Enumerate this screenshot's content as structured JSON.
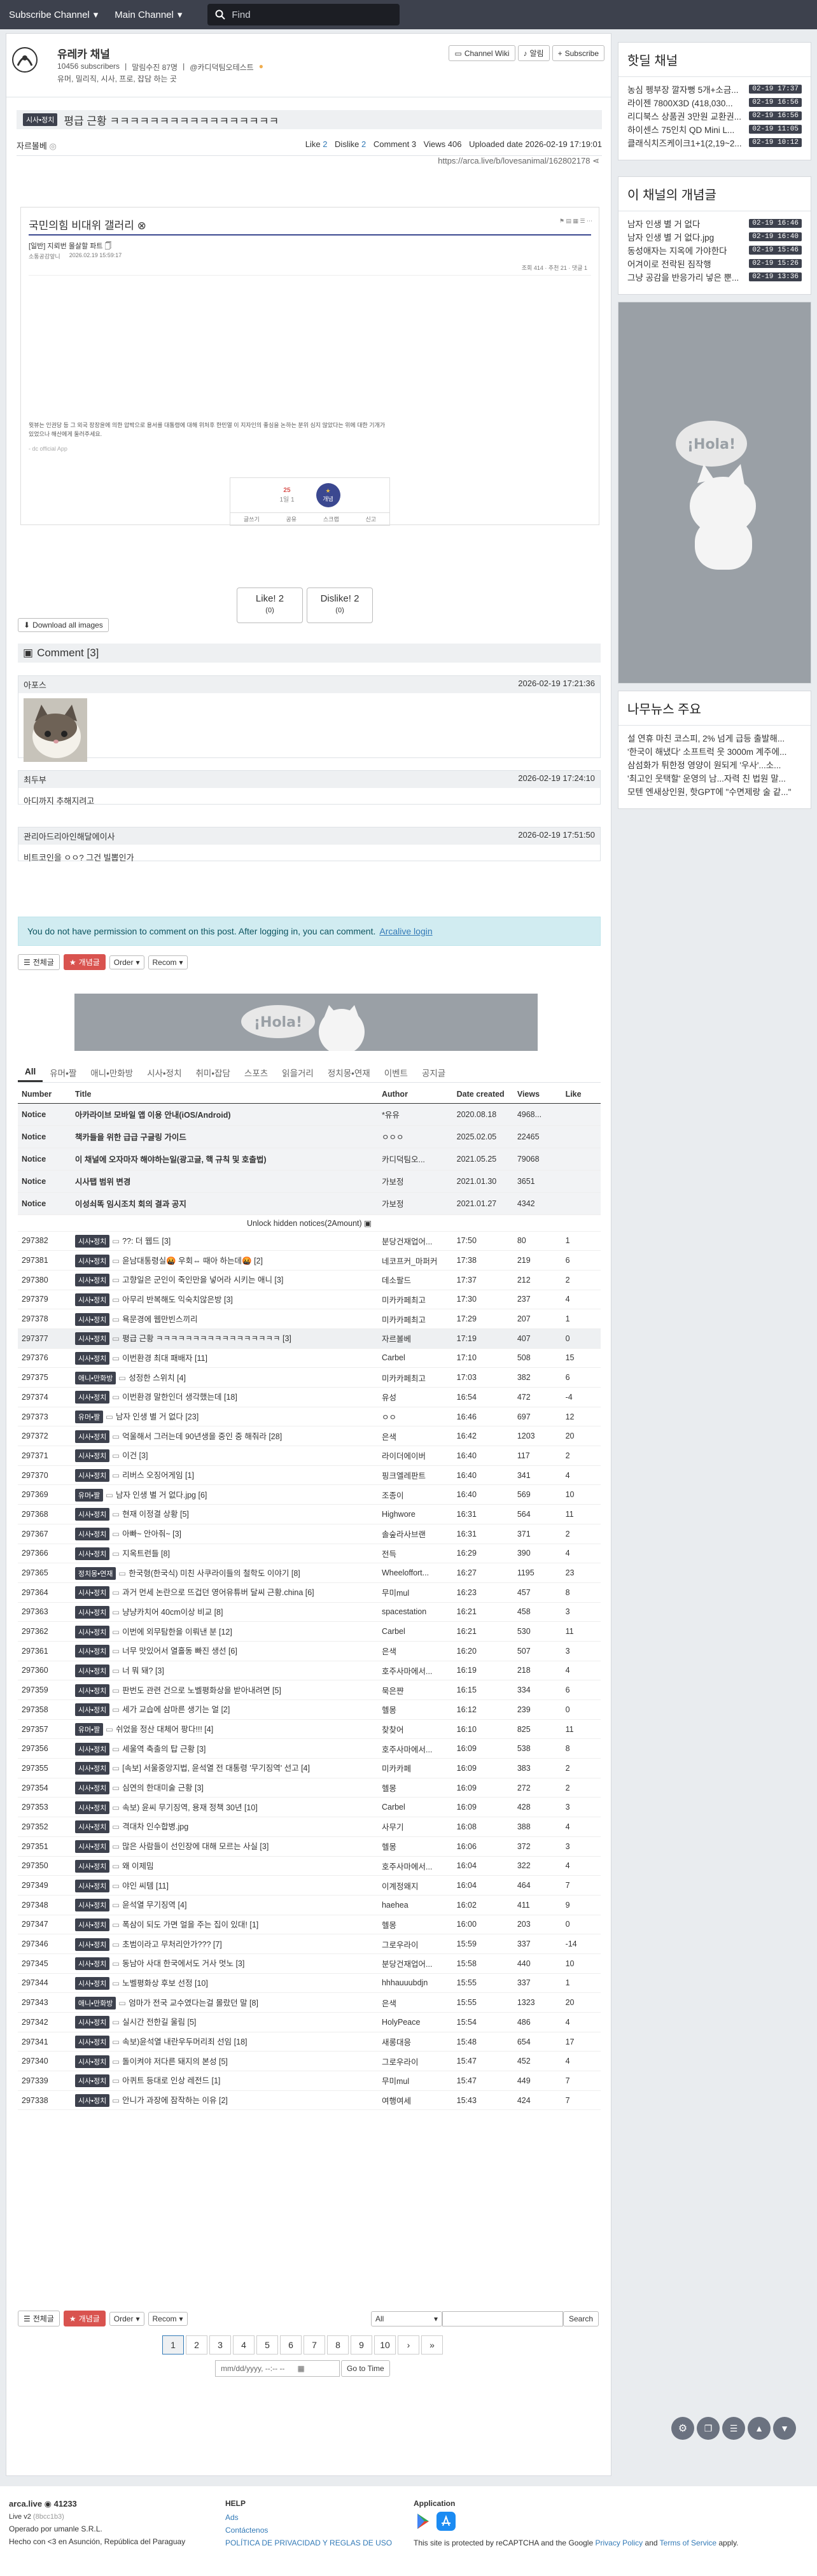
{
  "nav": {
    "subscribe": "Subscribe Channel",
    "main": "Main Channel",
    "search_placeholder": "Find"
  },
  "channel": {
    "title": "유레카 채널",
    "subscribers": "10456 subscribers",
    "admin": "말림수진 87명",
    "tag": "@카디덕팀오테스트",
    "desc": "유머, 밀리직, 시사, 프로, 잡담 하는 곳",
    "wiki": "Channel Wiki",
    "alarm": "알림",
    "subscribe": "Subscribe"
  },
  "post": {
    "category": "시사•정치",
    "title": "평급 근황 ㅋㅋㅋㅋㅋㅋㅋㅋㅋㅋㅋㅋㅋㅋㅋㅋㅋ",
    "author": "자르볼베",
    "like_label": "Like",
    "like": "2",
    "dislike_label": "Dislike",
    "dislike": "2",
    "comment_label": "Comment",
    "comment": "3",
    "views_label": "Views",
    "views": "406",
    "uploaded_label": "Uploaded date",
    "uploaded": "2026-02-19 17:19:01",
    "url": "https://arca.live/b/lovesanimal/162802178",
    "embed_title": "국민의힘 비대위 갤러리 ⊗",
    "embed_sub": "[일반] 지뢰번 몰살할 파트 🗍",
    "embed_author": "소통공감앞니",
    "embed_date": "2026.02.19 15:59:17",
    "embed_stats": "조회 414 · 추천 21 · 댓글 1",
    "embed_body": "윗뷰는 인권당 등 그 외국 장장윤에 의한 압박으로 용서를 대통령에 대해 위처후 한민열 이 지자인의 좋심을 논하는 분위 심지 않았다는 위에 대한 기개가\n있었으나 해산에게 둘러주세요.",
    "embed_src": "- dc official App",
    "react_cnt": "25",
    "react_sub": "1일 1",
    "react_btn": "개념",
    "act_write": "글쓰기",
    "act_share": "공유",
    "act_report": "신고",
    "act_copy": "스크랩"
  },
  "like_btn": {
    "like": "Like!",
    "like_n": "2",
    "like_sub": "0",
    "dislike": "Dislike!",
    "dislike_n": "2",
    "dislike_sub": "0"
  },
  "download": "Download all images",
  "comments_title": "Comment [3]",
  "comments": [
    {
      "author": "아포스",
      "date": "2026-02-19 17:21:36",
      "body": ""
    },
    {
      "author": "최두부",
      "date": "2026-02-19 17:24:10",
      "body": "아디까지 추해지려고"
    },
    {
      "author": "관리아드리아인해달에이사",
      "date": "2026-02-19 17:51:50",
      "body": "비트코인을 ㅇㅇ? 그건 빌뽑인가"
    }
  ],
  "alert": {
    "text": "You do not have permission to comment on this post. After logging in, you can comment.",
    "link": "Arcalive login"
  },
  "tools": {
    "all": "전체글",
    "best": "개념글",
    "order": "Order",
    "recom": "Recom"
  },
  "tabs": [
    "All",
    "유머•짤",
    "애니•만화방",
    "시사•정치",
    "취미•잡담",
    "스포츠",
    "읽을거리",
    "정치몽•연재",
    "이벤트",
    "공지글"
  ],
  "table_headers": {
    "number": "Number",
    "title": "Title",
    "author": "Author",
    "date": "Date created",
    "views": "Views",
    "like": "Like"
  },
  "notices": [
    {
      "title": "아카라이브 모바일 앱 이용 안내(iOS/Android)",
      "author": "*유유",
      "date": "2020.08.18",
      "views": "4968..."
    },
    {
      "title": "책카들을 위한 급급 구글링 가이드",
      "author": "ㅇㅇㅇ",
      "date": "2025.02.05",
      "views": "22465"
    },
    {
      "title": "이 채널에 오자마자 해야하는일(광고글, 핵 규칙 및 호출법)",
      "author": "카디덕팀오...",
      "date": "2021.05.25",
      "views": "79068"
    },
    {
      "title": "시사탭 범위 변경",
      "author": "가보정",
      "date": "2021.01.30",
      "views": "3651"
    },
    {
      "title": "이성쇠똑 임시조치 회의 결과 공지",
      "author": "가보정",
      "date": "2021.01.27",
      "views": "4342"
    }
  ],
  "notice_label": "Notice",
  "unlock": "Unlock hidden notices(2Amount)",
  "posts": [
    {
      "n": "297382",
      "c": "시사•정치",
      "t": "??: 더 웹드 [3]",
      "a": "분당건재업어...",
      "d": "17:50",
      "v": "80",
      "l": "1"
    },
    {
      "n": "297381",
      "c": "시사•정치",
      "t": "윤남대통령실🤬 우회⇔ 때아 하는데🤬 [2]",
      "a": "네코프커_마퍼커",
      "d": "17:38",
      "v": "219",
      "l": "6"
    },
    {
      "n": "297380",
      "c": "시사•정치",
      "t": "고향일은 군인이 죽인만을 넣어라 시키는 애니 [3]",
      "a": "데소팔드",
      "d": "17:37",
      "v": "212",
      "l": "2"
    },
    {
      "n": "297379",
      "c": "시사•정치",
      "t": "아무리 반복해도 익숙치않은방 [3]",
      "a": "미카카페최고",
      "d": "17:30",
      "v": "237",
      "l": "4"
    },
    {
      "n": "297378",
      "c": "시사•정치",
      "t": "욕문경에 웹만빈스끼리",
      "a": "미카카페최고",
      "d": "17:29",
      "v": "207",
      "l": "1"
    },
    {
      "n": "297377",
      "c": "시사•정치",
      "t": "평급 근황 ㅋㅋㅋㅋㅋㅋㅋㅋㅋㅋㅋㅋㅋㅋㅋㅋㅋ [3]",
      "a": "자르볼베",
      "d": "17:19",
      "v": "407",
      "l": "0"
    },
    {
      "n": "297376",
      "c": "시사•정치",
      "t": "이번환경 최대 패배자 [11]",
      "a": "Carbel",
      "d": "17:10",
      "v": "508",
      "l": "15"
    },
    {
      "n": "297375",
      "c": "애니•만화방",
      "t": "성정한 스위치 [4]",
      "a": "미카카페최고",
      "d": "17:03",
      "v": "382",
      "l": "6"
    },
    {
      "n": "297374",
      "c": "시사•정치",
      "t": "이번환경 말한인더 생각했는데 [18]",
      "a": "유성",
      "d": "16:54",
      "v": "472",
      "l": "-4"
    },
    {
      "n": "297373",
      "c": "유머•짤",
      "t": "남자 인생 별 거 없다 [23]",
      "a": "ㅇㅇ",
      "d": "16:46",
      "v": "697",
      "l": "12"
    },
    {
      "n": "297372",
      "c": "시사•정치",
      "t": "억울해서 그러는데 90년생을 중인 중 해줘라 [28]",
      "a": "은색",
      "d": "16:42",
      "v": "1203",
      "l": "20"
    },
    {
      "n": "297371",
      "c": "시사•정치",
      "t": "이건 [3]",
      "a": "라이더에이버",
      "d": "16:40",
      "v": "117",
      "l": "2"
    },
    {
      "n": "297370",
      "c": "시사•정치",
      "t": "리버스 오징어게임 [1]",
      "a": "핑크엘레판트",
      "d": "16:40",
      "v": "341",
      "l": "4"
    },
    {
      "n": "297369",
      "c": "유머•짤",
      "t": "남자 인생 별 거 없다.jpg [6]",
      "a": "조종이",
      "d": "16:40",
      "v": "569",
      "l": "10"
    },
    {
      "n": "297368",
      "c": "시사•정치",
      "t": "현재 이정결 상황 [5]",
      "a": "Highwore",
      "d": "16:31",
      "v": "564",
      "l": "11"
    },
    {
      "n": "297367",
      "c": "시사•정치",
      "t": "아빠~ 안아줘~ [3]",
      "a": "솔숲라사브랜",
      "d": "16:31",
      "v": "371",
      "l": "2"
    },
    {
      "n": "297366",
      "c": "시사•정치",
      "t": "지옥트런들 [8]",
      "a": "전득",
      "d": "16:29",
      "v": "390",
      "l": "4"
    },
    {
      "n": "297365",
      "c": "정치몽•연재",
      "t": "한국형(한국식) 미친 사쿠라이들의 철학도 이야기 [8]",
      "a": "Wheeloffort...",
      "d": "16:27",
      "v": "1195",
      "l": "23"
    },
    {
      "n": "297364",
      "c": "시사•정치",
      "t": "과거 먼세 논란으로 뜨겁던 영어유튜버 달씨 근황.china [6]",
      "a": "무미mul",
      "d": "16:23",
      "v": "457",
      "l": "8"
    },
    {
      "n": "297363",
      "c": "시사•정치",
      "t": "냥냥카치어 40cm이상 비교 [8]",
      "a": "spacestation",
      "d": "16:21",
      "v": "458",
      "l": "3"
    },
    {
      "n": "297362",
      "c": "시사•정치",
      "t": "이번에 외무탐한을 이뤄낸 분 [12]",
      "a": "Carbel",
      "d": "16:21",
      "v": "530",
      "l": "11"
    },
    {
      "n": "297361",
      "c": "시사•정치",
      "t": "너무 맛있어서 열흘동 빠진 생선 [6]",
      "a": "은색",
      "d": "16:20",
      "v": "507",
      "l": "3"
    },
    {
      "n": "297360",
      "c": "시사•정치",
      "t": "너 뭐 돼? [3]",
      "a": "호주사마에서...",
      "d": "16:19",
      "v": "218",
      "l": "4"
    },
    {
      "n": "297359",
      "c": "시사•정치",
      "t": "판번도 관련 건으로 노벨평화상을 받아내려면 [5]",
      "a": "묵은쨘",
      "d": "16:15",
      "v": "334",
      "l": "6"
    },
    {
      "n": "297358",
      "c": "시사•정치",
      "t": "세가 교습에 삼마른 생기는 얼 [2]",
      "a": "헬몽",
      "d": "16:12",
      "v": "239",
      "l": "0"
    },
    {
      "n": "297357",
      "c": "유머•짤",
      "t": "쉬었을 정산 대체어 팡다!!! [4]",
      "a": "찾찾어",
      "d": "16:10",
      "v": "825",
      "l": "11"
    },
    {
      "n": "297356",
      "c": "시사•정치",
      "t": "세울역 축출의 탑 근황 [3]",
      "a": "호주사마에서...",
      "d": "16:09",
      "v": "538",
      "l": "8"
    },
    {
      "n": "297355",
      "c": "시사•정치",
      "t": "[속보] 서울중앙지법, 윤석열 전 대통령 '무기징역' 선고 [4]",
      "a": "미카카페",
      "d": "16:09",
      "v": "383",
      "l": "2"
    },
    {
      "n": "297354",
      "c": "시사•정치",
      "t": "심연의 한대미술 근황 [3]",
      "a": "헬몽",
      "d": "16:09",
      "v": "272",
      "l": "2"
    },
    {
      "n": "297353",
      "c": "시사•정치",
      "t": "속보) 윤씨 무기징역, 용재 정책 30년 [10]",
      "a": "Carbel",
      "d": "16:09",
      "v": "428",
      "l": "3"
    },
    {
      "n": "297352",
      "c": "시사•정치",
      "t": "격대차 인수합병.jpg",
      "a": "사무기",
      "d": "16:08",
      "v": "388",
      "l": "4"
    },
    {
      "n": "297351",
      "c": "시사•정치",
      "t": "많은 사람들이 선인장에 대해 모르는 사실 [3]",
      "a": "헬몽",
      "d": "16:06",
      "v": "372",
      "l": "3"
    },
    {
      "n": "297350",
      "c": "시사•정치",
      "t": "왜 이제밈",
      "a": "호주사마에서...",
      "d": "16:04",
      "v": "322",
      "l": "4"
    },
    {
      "n": "297349",
      "c": "시사•정치",
      "t": "야인 씨템 [11]",
      "a": "이계정왜지",
      "d": "16:04",
      "v": "464",
      "l": "7"
    },
    {
      "n": "297348",
      "c": "시사•정치",
      "t": "윤석열 무기징역 [4]",
      "a": "haehea",
      "d": "16:02",
      "v": "411",
      "l": "9"
    },
    {
      "n": "297347",
      "c": "시사•정치",
      "t": "폭삼이 되도 가면 얼을 주는 집이 있대! [1]",
      "a": "헬몽",
      "d": "16:00",
      "v": "203",
      "l": "0"
    },
    {
      "n": "297346",
      "c": "시사•정치",
      "t": "초범이라고 무처리안가??? [7]",
      "a": "그로우라이",
      "d": "15:59",
      "v": "337",
      "l": "-14"
    },
    {
      "n": "297345",
      "c": "시사•정치",
      "t": "동남아 사대 한국에서도 거사 멋노 [3]",
      "a": "분당건재업어...",
      "d": "15:58",
      "v": "440",
      "l": "10"
    },
    {
      "n": "297344",
      "c": "시사•정치",
      "t": "노벨평화상 후보 선정 [10]",
      "a": "hhhauuubdjn",
      "d": "15:55",
      "v": "337",
      "l": "1"
    },
    {
      "n": "297343",
      "c": "애니•만화방",
      "t": "엄마가 전국 교수였다는걸 몰랐던 말 [8]",
      "a": "은색",
      "d": "15:55",
      "v": "1323",
      "l": "20"
    },
    {
      "n": "297342",
      "c": "시사•정치",
      "t": "실시간 전한길 울림 [5]",
      "a": "HolyPeace",
      "d": "15:54",
      "v": "486",
      "l": "4"
    },
    {
      "n": "297341",
      "c": "시사•정치",
      "t": "속보)윤석열 내란우두머리죄 선임 [18]",
      "a": "새롱대응",
      "d": "15:48",
      "v": "654",
      "l": "17"
    },
    {
      "n": "297340",
      "c": "시사•정치",
      "t": "돌이켜야 저다른 돼지의 본성 [5]",
      "a": "그로우라이",
      "d": "15:47",
      "v": "452",
      "l": "4"
    },
    {
      "n": "297339",
      "c": "시사•정치",
      "t": "아퀴트 등대로 인상 레전드 [1]",
      "a": "무미mul",
      "d": "15:47",
      "v": "449",
      "l": "7"
    },
    {
      "n": "297338",
      "c": "시사•정치",
      "t": "안니가 과장에 잠작하는 이유 [2]",
      "a": "여행여세",
      "d": "15:43",
      "v": "424",
      "l": "7"
    }
  ],
  "bottom": {
    "all": "전체글",
    "best": "개념글",
    "order": "Order",
    "recom": "Recom",
    "search_scope": "All",
    "search_btn": "Search",
    "date_placeholder": "mm/dd/yyyy, --:-- --",
    "go": "Go to Time"
  },
  "pages": [
    "1",
    "2",
    "3",
    "4",
    "5",
    "6",
    "7",
    "8",
    "9",
    "10"
  ],
  "side_hot": {
    "title": "핫딜 채널",
    "items": [
      {
        "t": "농심 펭부장 깔자뻥 5개+소금...",
        "ts": "02-19 17:37"
      },
      {
        "t": "라이젠 7800X3D (418,030...",
        "ts": "02-19 16:56"
      },
      {
        "t": "리디북스 상품권 3만원 교환권...",
        "ts": "02-19 16:56"
      },
      {
        "t": "하이센스 75인치 QD Mini L...",
        "ts": "02-19 11:05"
      },
      {
        "t": "클래식치즈케이크1+1(2,19~2...",
        "ts": "02-19 10:12"
      }
    ]
  },
  "side_best": {
    "title": "이 채널의 개념글",
    "items": [
      {
        "t": "남자 인생 별 거 없다",
        "ts": "02-19 16:46"
      },
      {
        "t": "남자 인생 별 거 없다.jpg",
        "ts": "02-19 16:40"
      },
      {
        "t": "동성애자는 지옥에 가야한다",
        "ts": "02-19 15:46"
      },
      {
        "t": "어겨이로 전락된 짐작행",
        "ts": "02-19 15:26"
      },
      {
        "t": "그냥 공감을 반응가리 넣은 뿐...",
        "ts": "02-19 13:36"
      }
    ]
  },
  "side_news": {
    "title": "나무뉴스 주요",
    "items": [
      "설 연휴 마친 코스피, 2% 넘게 급등 출발해...",
      "'한국이 해냈다' 소프트럭 웃 3000m 계주에...",
      "삼섬화가 튀한정 영양이 원되게 '우사'...소...",
      "'최고인 웃택할' 운영의 남...자력 친 법원 말...",
      "모텐 엔새상인원, 핫GPT에 \"수면제랑 술 같...\""
    ]
  },
  "hola": "¡Hola!",
  "footer": {
    "brand": "arca.live",
    "count": "41233",
    "ver": "Live v2",
    "ver_sub": "(8bcc1b3)",
    "operator": "Operado por umanle S.R.L.",
    "hecho": "Hecho con <3 en Asunción, República del Paraguay",
    "help": "HELP",
    "ads": "Ads",
    "contact": "Contáctenos",
    "policy": "POLÍTICA DE PRIVACIDAD Y REGLAS DE USO",
    "app": "Application",
    "recaptcha": "This site is protected by reCAPTCHA and the Google",
    "privacy": "Privacy Policy",
    "and": "and",
    "terms": "Terms of Service",
    "apply": "apply."
  }
}
